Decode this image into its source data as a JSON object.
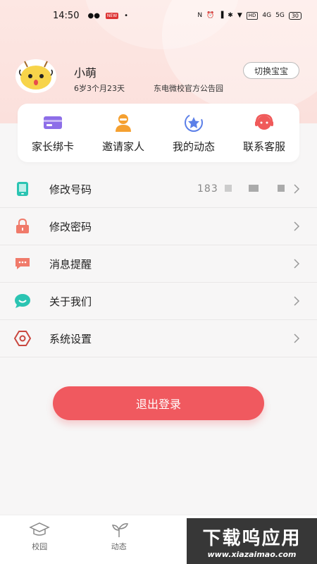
{
  "status_bar": {
    "time": "14:50",
    "app_badge": "NEW",
    "hd_label": "HD",
    "signal_1": "4G",
    "signal_2": "5G",
    "battery": "30"
  },
  "profile": {
    "name": "小萌",
    "age": "6岁3个月23天",
    "school": "东电微校官方公告园",
    "switch_label": "切换宝宝"
  },
  "quick_actions": [
    {
      "label": "家长绑卡",
      "icon": "card-icon",
      "color": "#8d6ee8"
    },
    {
      "label": "邀请家人",
      "icon": "person-icon",
      "color": "#f5a030"
    },
    {
      "label": "我的动态",
      "icon": "star-icon",
      "color": "#5b7fe8"
    },
    {
      "label": "联系客服",
      "icon": "headset-icon",
      "color": "#f05a5a"
    }
  ],
  "menu": [
    {
      "label": "修改号码",
      "value": "183",
      "icon": "phone-icon",
      "color": "#2bc4b2"
    },
    {
      "label": "修改密码",
      "value": "",
      "icon": "lock-icon",
      "color": "#f07a6a"
    },
    {
      "label": "消息提醒",
      "value": "",
      "icon": "message-icon",
      "color": "#f07a6a"
    },
    {
      "label": "关于我们",
      "value": "",
      "icon": "chat-bubble-icon",
      "color": "#2bc4b2"
    },
    {
      "label": "系统设置",
      "value": "",
      "icon": "gear-icon",
      "color": "#d9534f"
    }
  ],
  "logout_label": "退出登录",
  "tabs": [
    {
      "label": "校园",
      "icon": "graduation-cap-icon"
    },
    {
      "label": "动态",
      "icon": "sprout-icon"
    },
    {
      "label": "",
      "icon": "tab-icon"
    },
    {
      "label": "",
      "icon": "profile-icon"
    }
  ],
  "watermark": {
    "big": "下载呜应用",
    "small": "www.xiazaimao.com"
  }
}
